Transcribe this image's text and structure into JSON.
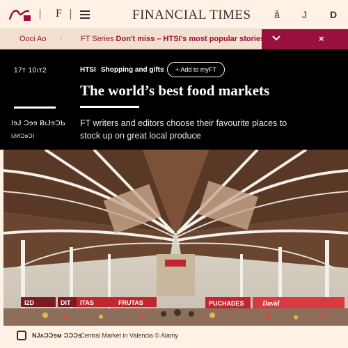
{
  "header": {
    "masthead": "FINANCIAL TIMES",
    "left_segments": [
      "|",
      "F",
      "|"
    ],
    "user_label": "å",
    "j_label": "J",
    "d_label": "D",
    "icons": [
      "ft-logo-icon",
      "menu-icon",
      "user-icon"
    ]
  },
  "promo": {
    "left_label": "Ooci Ao",
    "dot": "·",
    "prefix": "FT Series ",
    "bold": "Don't miss – HTSI's most popular stories",
    "close": "×",
    "colors": {
      "accent": "#990f3d",
      "strip": "#f2dfce"
    }
  },
  "article": {
    "dateline": "17ᴛ 10ıᴛ2",
    "section": "HTSI",
    "topic": "Shopping and gifts",
    "add_label": "+ Add to myFT",
    "headline": "The world’s best food markets",
    "standfirst": "FT writers and editors choose their favourite places to stock up on great local produce",
    "byline_1": "IɘɈ Ɔɘɘ ɃıɈɘƆƄ",
    "byline_2": "IɈИƆɘƆI"
  },
  "photo": {
    "signs": [
      "I2D",
      "DIT",
      "ITAS",
      "FRUTAS",
      "PUCHADES",
      "David"
    ],
    "colors": {
      "roof": "#5a3826",
      "iron": "#f3f0ea",
      "sign_red": "#c0262d"
    }
  },
  "caption": {
    "label": "ǊʌƆƆɘᴍ ƆƆƆɘ",
    "text": "Central Market in Valencia © Alamy"
  }
}
